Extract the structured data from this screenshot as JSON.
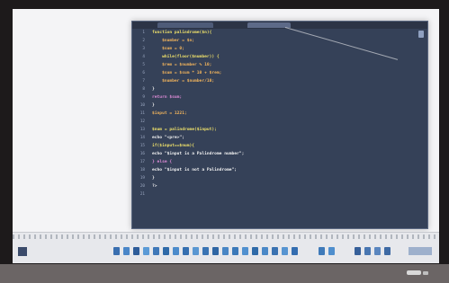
{
  "editor": {
    "line_numbers": [
      "1",
      "2",
      "3",
      "4",
      "5",
      "6",
      "7",
      "8",
      "9",
      "10",
      "11",
      "12",
      "13",
      "14",
      "15",
      "16",
      "17",
      "18",
      "19",
      "20",
      "21"
    ],
    "code_lines": [
      "function palindrome($n){",
      "    $number = $n;",
      "    $sum = 0;",
      "    while(floor($number)) {",
      "    $rem = $number % 10;",
      "    $sum = $sum * 10 + $rem;",
      "    $number = $number/10;",
      "}",
      "return $sum;",
      "}",
      "$input = 1221;",
      "",
      "$num = palindrome($input);",
      "echo \"<pre>\";",
      "if($input==$num){",
      "echo \"$input is a Palindrome number\";",
      "} else {",
      "echo \"$input is not a Palindrome\";",
      "}",
      "?>"
    ]
  },
  "colors": {
    "editor_bg": "#354158",
    "keyword": "#f0e26a",
    "variable": "#f2b45c"
  }
}
